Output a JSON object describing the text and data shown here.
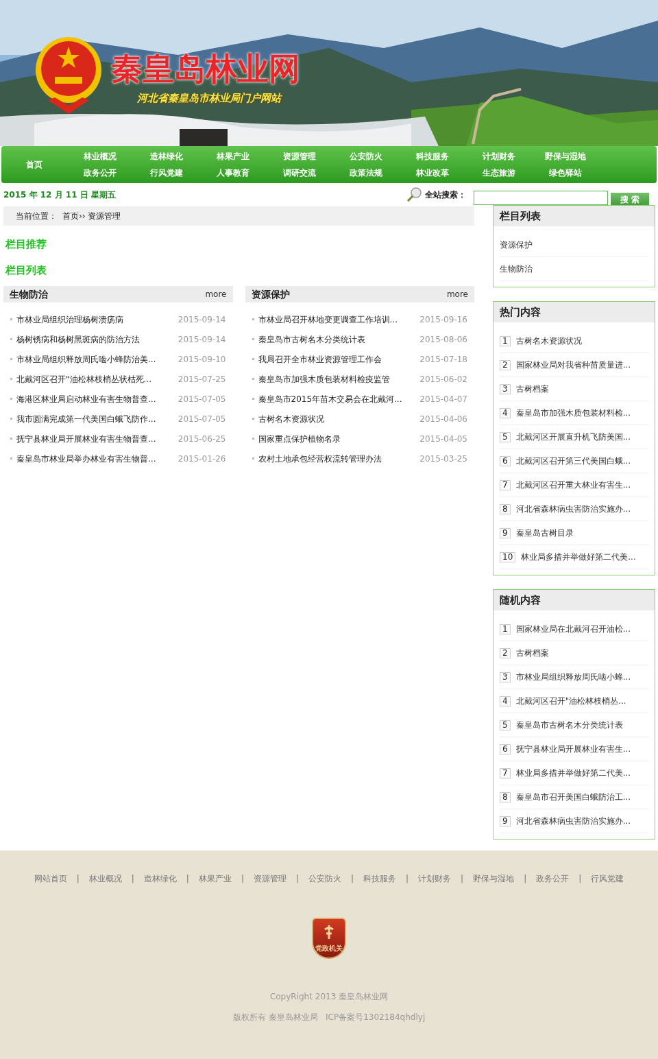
{
  "header": {
    "title": "秦皇岛林业网",
    "subtitle": "河北省秦皇岛市林业局门户网站"
  },
  "nav": {
    "home": "首页",
    "columns": [
      [
        "林业概况",
        "政务公开"
      ],
      [
        "造林绿化",
        "行风党建"
      ],
      [
        "林果产业",
        "人事教育"
      ],
      [
        "资源管理",
        "调研交流"
      ],
      [
        "公安防火",
        "政策法规"
      ],
      [
        "科技服务",
        "林业改革"
      ],
      [
        "计划财务",
        "生态旅游"
      ],
      [
        "野保与湿地",
        "绿色驿站"
      ]
    ]
  },
  "date": "2015 年 12 月 11 日 星期五",
  "search": {
    "label": "全站搜索：",
    "button": "搜 索"
  },
  "breadcrumb": {
    "label": "当前位置：",
    "path": "首页›› 资源管理"
  },
  "section_titles": [
    "栏目推荐",
    "栏目列表"
  ],
  "lists": [
    {
      "title": "生物防治",
      "more": "more",
      "items": [
        {
          "text": "市林业局组织治理杨树溃疡病",
          "date": "2015-09-14"
        },
        {
          "text": "杨树锈病和杨树黑斑病的防治方法",
          "date": "2015-09-14"
        },
        {
          "text": "市林业局组织释放周氏啮小蜂防治美...",
          "date": "2015-09-10"
        },
        {
          "text": "北戴河区召开\"油松林枝梢丛状枯死...",
          "date": "2015-07-25"
        },
        {
          "text": "海港区林业局启动林业有害生物普查...",
          "date": "2015-07-05"
        },
        {
          "text": "我市圆满完成第一代美国白蛾飞防作...",
          "date": "2015-07-05"
        },
        {
          "text": "抚宁县林业局开展林业有害生物普查...",
          "date": "2015-06-25"
        },
        {
          "text": "秦皇岛市林业局举办林业有害生物普...",
          "date": "2015-01-26"
        }
      ]
    },
    {
      "title": "资源保护",
      "more": "more",
      "items": [
        {
          "text": "市林业局召开林地变更调查工作培训...",
          "date": "2015-09-16"
        },
        {
          "text": "秦皇岛市古树名木分类统计表",
          "date": "2015-08-06"
        },
        {
          "text": "我局召开全市林业资源管理工作会",
          "date": "2015-07-18"
        },
        {
          "text": "秦皇岛市加强木质包装材料检疫监管",
          "date": "2015-06-02"
        },
        {
          "text": "秦皇岛市2015年苗木交易会在北戴河...",
          "date": "2015-04-07"
        },
        {
          "text": "古树名木资源状况",
          "date": "2015-04-06"
        },
        {
          "text": "国家重点保护植物名录",
          "date": "2015-04-05"
        },
        {
          "text": "农村土地承包经营权流转管理办法",
          "date": "2015-03-25"
        }
      ]
    }
  ],
  "sidebar": [
    {
      "kind": "plain",
      "title": "栏目列表",
      "items": [
        {
          "text": "资源保护"
        },
        {
          "text": "生物防治"
        }
      ]
    },
    {
      "kind": "numbered",
      "title": "热门内容",
      "items": [
        {
          "num": "1",
          "text": "古树名木资源状况"
        },
        {
          "num": "2",
          "text": "国家林业局对我省种苗质量进..."
        },
        {
          "num": "3",
          "text": "古树档案"
        },
        {
          "num": "4",
          "text": "秦皇岛市加强木质包装材料检..."
        },
        {
          "num": "5",
          "text": "北戴河区开展直升机飞防美国..."
        },
        {
          "num": "6",
          "text": "北戴河区召开第三代美国白蛾..."
        },
        {
          "num": "7",
          "text": "北戴河区召开重大林业有害生..."
        },
        {
          "num": "8",
          "text": "河北省森林病虫害防治实施办..."
        },
        {
          "num": "9",
          "text": "秦皇岛古树目录"
        },
        {
          "num": "10",
          "text": "林业局多措并举做好第二代美..."
        }
      ]
    },
    {
      "kind": "numbered",
      "title": "随机内容",
      "items": [
        {
          "num": "1",
          "text": "国家林业局在北戴河召开油松..."
        },
        {
          "num": "2",
          "text": "古树档案"
        },
        {
          "num": "3",
          "text": "市林业局组织释放周氏啮小蜂..."
        },
        {
          "num": "4",
          "text": "北戴河区召开\"油松林枝梢丛..."
        },
        {
          "num": "5",
          "text": "秦皇岛市古树名木分类统计表"
        },
        {
          "num": "6",
          "text": "抚宁县林业局开展林业有害生..."
        },
        {
          "num": "7",
          "text": "林业局多措并举做好第二代美..."
        },
        {
          "num": "8",
          "text": "秦皇岛市召开美国白蛾防治工..."
        },
        {
          "num": "9",
          "text": "河北省森林病虫害防治实施办..."
        }
      ]
    }
  ],
  "footer": {
    "links": [
      "网站首页",
      "林业概况",
      "造林绿化",
      "林果产业",
      "资源管理",
      "公安防火",
      "科技服务",
      "计划财务",
      "野保与湿地",
      "政务公开",
      "行风党建"
    ],
    "separator": "|",
    "badge": "党政机关",
    "copyright": "CopyRight 2013 秦皇岛林业网",
    "record": "版权所有 秦皇岛林业局   ICP备案号1302184qhdlyj"
  }
}
